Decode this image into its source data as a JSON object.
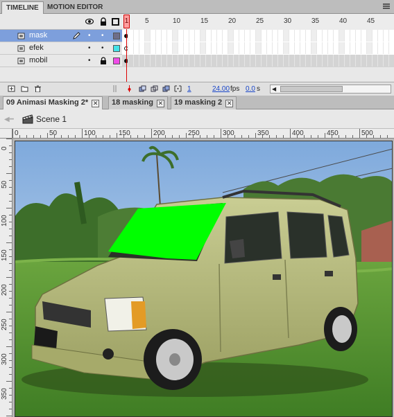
{
  "panel_tabs": {
    "timeline": "TIMELINE",
    "motion_editor": "MOTION EDITOR"
  },
  "frame_numbers": [
    "1",
    "5",
    "10",
    "15",
    "20",
    "25",
    "30",
    "35",
    "40",
    "45"
  ],
  "layers": [
    {
      "name": "mask",
      "color": "#6e6e8a",
      "selected": true,
      "locked": false
    },
    {
      "name": "efek",
      "color": "#43e2e8",
      "selected": false,
      "locked": false
    },
    {
      "name": "mobil",
      "color": "#f04be8",
      "selected": false,
      "locked": true
    }
  ],
  "status": {
    "frame": "1",
    "fps": "24.00",
    "fps_unit": "fps",
    "time": "0.0",
    "time_unit": "s"
  },
  "doc_tabs": [
    "09 Animasi Masking 2*",
    "18 masking",
    "19 masking 2"
  ],
  "scene": {
    "label": "Scene 1"
  },
  "ruler_h": [
    "0",
    "50",
    "100",
    "150",
    "200",
    "250",
    "300",
    "350",
    "400",
    "450",
    "500"
  ],
  "ruler_v": [
    "0",
    "50",
    "100",
    "150",
    "200",
    "250",
    "300",
    "350"
  ],
  "stage": {
    "mask_color": "#00ff00",
    "car_color": "#b5b97a"
  }
}
